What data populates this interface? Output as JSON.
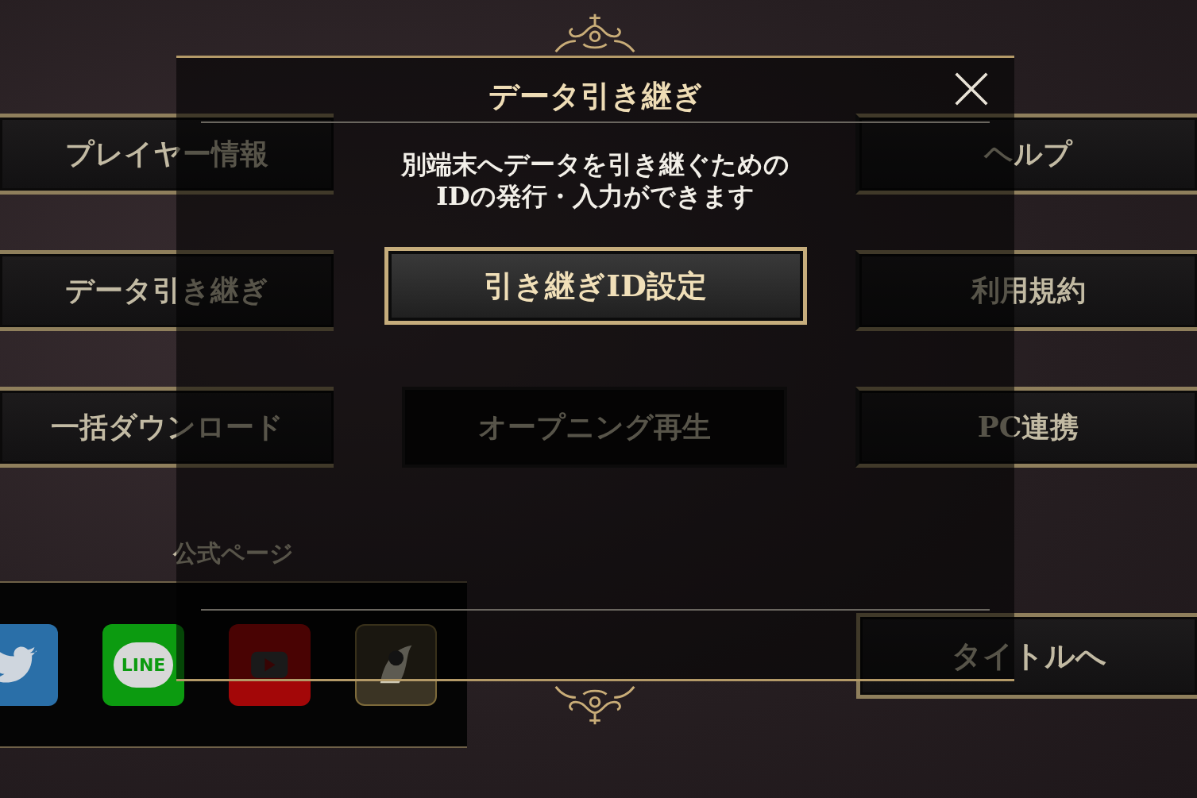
{
  "menu_columns": [
    {
      "buttons": [
        {
          "label": "プレイヤー情報"
        },
        {
          "label": "データ引き継ぎ"
        },
        {
          "label": "一括ダウンロード"
        }
      ]
    },
    {
      "buttons": [
        {
          "label": "オープニング再生"
        }
      ]
    },
    {
      "buttons": [
        {
          "label": "ヘルプ"
        },
        {
          "label": "利用規約"
        },
        {
          "label": "PC連携"
        }
      ]
    }
  ],
  "official_links": {
    "title": "公式ページ",
    "links": [
      {
        "kind": "twitter"
      },
      {
        "kind": "line",
        "label": "LINE"
      },
      {
        "kind": "youtube"
      },
      {
        "kind": "game"
      }
    ]
  },
  "title_button": {
    "label": "タイトルへ"
  },
  "dialog": {
    "title": "データ引き継ぎ",
    "message": "別端末へデータを引き継ぐための\nIDの発行・入力ができます",
    "action_button": {
      "label": "引き継ぎID設定"
    }
  }
}
